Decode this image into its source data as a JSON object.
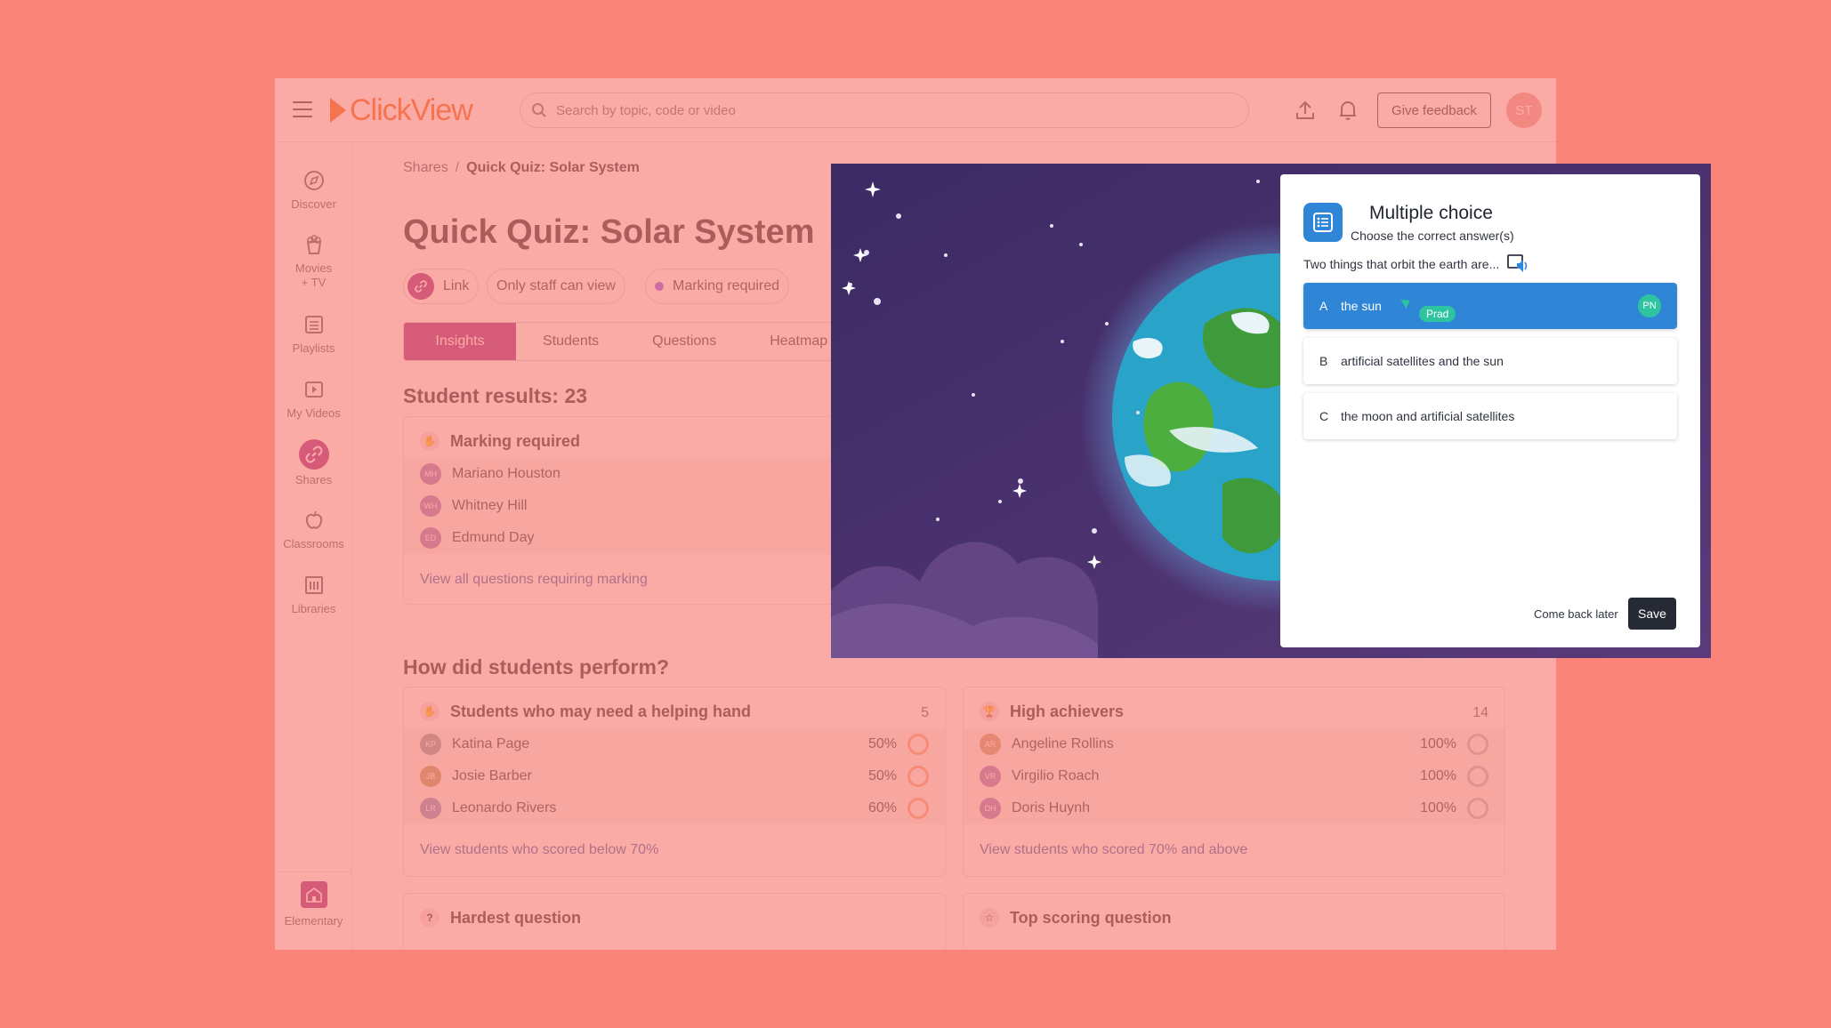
{
  "app": {
    "brand": "ClickView",
    "search": {
      "placeholder": "Search by topic, code or video"
    },
    "feedback_label": "Give feedback",
    "avatar_initials": "ST"
  },
  "sidebar": {
    "items": [
      {
        "label": "Discover",
        "icon": "compass-icon"
      },
      {
        "label": "Movies + TV",
        "icon": "popcorn-icon"
      },
      {
        "label": "Playlists",
        "icon": "list-icon"
      },
      {
        "label": "My Videos",
        "icon": "video-icon"
      },
      {
        "label": "Shares",
        "icon": "link-icon",
        "active": true
      },
      {
        "label": "Classrooms",
        "icon": "apple-icon"
      },
      {
        "label": "Libraries",
        "icon": "library-icon"
      }
    ],
    "bottom_label": "Elementary"
  },
  "breadcrumb": {
    "root": "Shares",
    "separator": "/",
    "current": "Quick Quiz: Solar System"
  },
  "page": {
    "title": "Quick Quiz: Solar System",
    "chips": {
      "link": "Link",
      "visibility": "Only staff can view",
      "marking": "Marking required"
    },
    "tabs": [
      "Insights",
      "Students",
      "Questions",
      "Heatmap"
    ],
    "results_heading": "Student results: 23",
    "marking_card": {
      "title": "Marking required",
      "students": [
        {
          "initials": "MH",
          "name": "Mariano Houston"
        },
        {
          "initials": "WH",
          "name": "Whitney Hill"
        },
        {
          "initials": "ED",
          "name": "Edmund Day"
        }
      ],
      "link": "View all questions requiring marking"
    },
    "perform_heading": "How did students perform?",
    "helping_card": {
      "title": "Students who may need a helping hand",
      "count": "5",
      "students": [
        {
          "initials": "KP",
          "name": "Katina Page",
          "score": "50%"
        },
        {
          "initials": "JB",
          "name": "Josie Barber",
          "score": "50%"
        },
        {
          "initials": "LR",
          "name": "Leonardo Rivers",
          "score": "60%"
        }
      ],
      "link": "View students who scored below 70%"
    },
    "achievers_card": {
      "title": "High achievers",
      "count": "14",
      "students": [
        {
          "initials": "AR",
          "name": "Angeline Rollins",
          "score": "100%"
        },
        {
          "initials": "VR",
          "name": "Virgilio Roach",
          "score": "100%"
        },
        {
          "initials": "DH",
          "name": "Doris Huynh",
          "score": "100%"
        }
      ],
      "link": "View students who scored 70% and above"
    },
    "hardest_card": {
      "title": "Hardest question"
    },
    "top_card": {
      "title": "Top scoring question"
    }
  },
  "quiz": {
    "type_title": "Multiple choice",
    "instruction": "Choose the correct answer(s)",
    "question": "Two things that orbit the earth are...",
    "options": [
      {
        "letter": "A",
        "text": "the sun",
        "selected": true,
        "responder_initials": "PN",
        "responder_tag": "Prad"
      },
      {
        "letter": "B",
        "text": "artificial satellites and the sun"
      },
      {
        "letter": "C",
        "text": "the moon and artificial satellites"
      }
    ],
    "come_back_label": "Come back later",
    "save_label": "Save"
  },
  "colors": {
    "background": "#fa837a",
    "brand_orange": "#f26d21",
    "accent_purple": "#9b2d8a",
    "quiz_blue": "#2f86d6",
    "responder_green": "#2fc4a0"
  }
}
